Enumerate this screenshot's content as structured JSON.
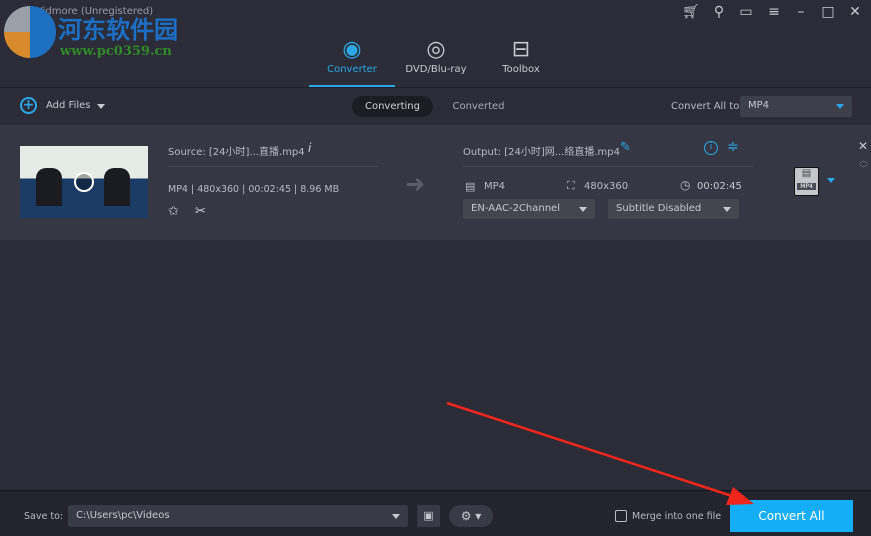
{
  "app": {
    "title": "Vidmore (Unregistered)"
  },
  "watermark": {
    "name": "河东软件园",
    "url": "www.pc0359.cn"
  },
  "window_controls": [
    "cart-icon",
    "key-icon",
    "feedback-icon",
    "menu-icon",
    "minimize-icon",
    "maximize-icon",
    "close-icon"
  ],
  "nav": [
    {
      "label": "Converter",
      "icon": "converter-icon",
      "active": true
    },
    {
      "label": "DVD/Blu-ray",
      "icon": "disc-icon"
    },
    {
      "label": "Toolbox",
      "icon": "toolbox-icon"
    }
  ],
  "toolbar": {
    "add_files": "Add Files",
    "tabs": [
      "Converting",
      "Converted"
    ],
    "convert_all_to_label": "Convert All to:",
    "convert_all_to_value": "MP4"
  },
  "file": {
    "source": "Source: [24小时]...直播.mp4",
    "info": "MP4 | 480x360 | 00:02:45 | 8.96 MB",
    "output": "Output: [24小时]网...络直播.mp4",
    "out_format": "MP4",
    "out_resolution": "480x360",
    "out_duration": "00:02:45",
    "audio": "EN-AAC-2Channel",
    "subtitle": "Subtitle Disabled",
    "format_badge": "MP4"
  },
  "bottom": {
    "save_to_label": "Save to:",
    "save_path": "C:\\Users\\pc\\Videos",
    "merge_label": "Merge into one file",
    "merge_checked": false,
    "convert_all": "Convert All"
  },
  "colors": {
    "accent": "#2aa7e6",
    "convert_button": "#13aef5",
    "annotation_arrow": "#f0261c"
  }
}
